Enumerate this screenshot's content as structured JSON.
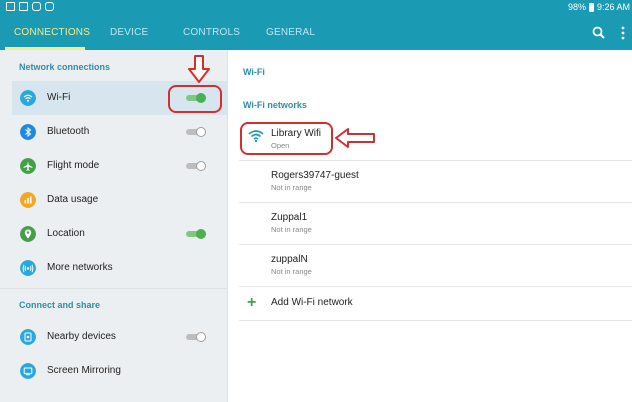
{
  "status_bar": {
    "battery": "98%",
    "time": "9:26 AM"
  },
  "tabs": [
    {
      "label": "CONNECTIONS",
      "active": true
    },
    {
      "label": "DEVICE",
      "active": false
    },
    {
      "label": "CONTROLS",
      "active": false
    },
    {
      "label": "GENERAL",
      "active": false
    }
  ],
  "toolbar": {
    "search_icon": "search-icon",
    "more_icon": "more-vert-icon"
  },
  "sidebar": {
    "section1": "Network connections",
    "section2": "Connect and share",
    "items": [
      {
        "label": "Wi-Fi",
        "icon": "wifi-icon",
        "color": "#29a8e0",
        "toggle": "on"
      },
      {
        "label": "Bluetooth",
        "icon": "bluetooth-icon",
        "color": "#1e88e5",
        "toggle": "off"
      },
      {
        "label": "Flight mode",
        "icon": "airplane-icon",
        "color": "#43a047",
        "toggle": "off"
      },
      {
        "label": "Data usage",
        "icon": "data-usage-icon",
        "color": "#f5a623",
        "toggle": null
      },
      {
        "label": "Location",
        "icon": "location-icon",
        "color": "#43a047",
        "toggle": "on"
      },
      {
        "label": "More networks",
        "icon": "more-networks-icon",
        "color": "#29a8e0",
        "toggle": null
      },
      {
        "label": "Nearby devices",
        "icon": "nearby-devices-icon",
        "color": "#29a8e0",
        "toggle": "off"
      },
      {
        "label": "Screen Mirroring",
        "icon": "screen-mirroring-icon",
        "color": "#29a8e0",
        "toggle": null
      }
    ]
  },
  "main": {
    "wifi_header": "Wi-Fi",
    "networks_header": "Wi-Fi networks",
    "networks": [
      {
        "name": "Library Wifi",
        "status": "Open"
      },
      {
        "name": "Rogers39747-guest",
        "status": "Not in range"
      },
      {
        "name": "Zuppal1",
        "status": "Not in range"
      },
      {
        "name": "zuppalN",
        "status": "Not in range"
      }
    ],
    "add_network": "Add Wi-Fi network"
  },
  "colors": {
    "accent": "#1a9ab3",
    "tab_active": "#f7ea8a",
    "annotation": "#d32f2f"
  }
}
